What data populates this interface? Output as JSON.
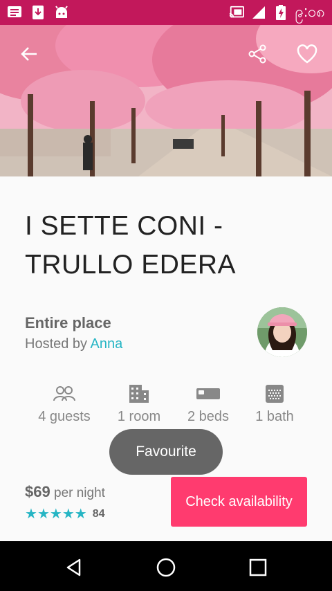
{
  "status_bar": {
    "time": "၉:၀၈",
    "icons": [
      "message-icon",
      "download-icon",
      "android-icon",
      "cast-icon",
      "signal-icon",
      "battery-charging-icon"
    ]
  },
  "hero": {
    "back_icon": "arrow-back-icon",
    "share_icon": "share-icon",
    "favorite_icon": "heart-outline-icon"
  },
  "listing": {
    "title": "I SETTE CONI - TRULLO EDERA",
    "property_type": "Entire place",
    "hosted_by_prefix": "Hosted by",
    "host_name": "Anna"
  },
  "amenities": [
    {
      "icon": "guests-icon",
      "label": "4 guests"
    },
    {
      "icon": "building-icon",
      "label": "1 room"
    },
    {
      "icon": "bed-icon",
      "label": "2 beds"
    },
    {
      "icon": "bath-icon",
      "label": "1 bath"
    }
  ],
  "toast": {
    "text": "Favourite"
  },
  "pricing": {
    "price": "$69",
    "per": "per night",
    "rating_stars": 5,
    "review_count": "84"
  },
  "cta": {
    "label": "Check availability"
  },
  "colors": {
    "status_bar": "#c2185b",
    "accent_teal": "#26b5c4",
    "cta_pink": "#ff3b6f"
  },
  "nav_bar": {
    "icons": [
      "back-triangle-icon",
      "home-circle-icon",
      "recents-square-icon"
    ]
  }
}
